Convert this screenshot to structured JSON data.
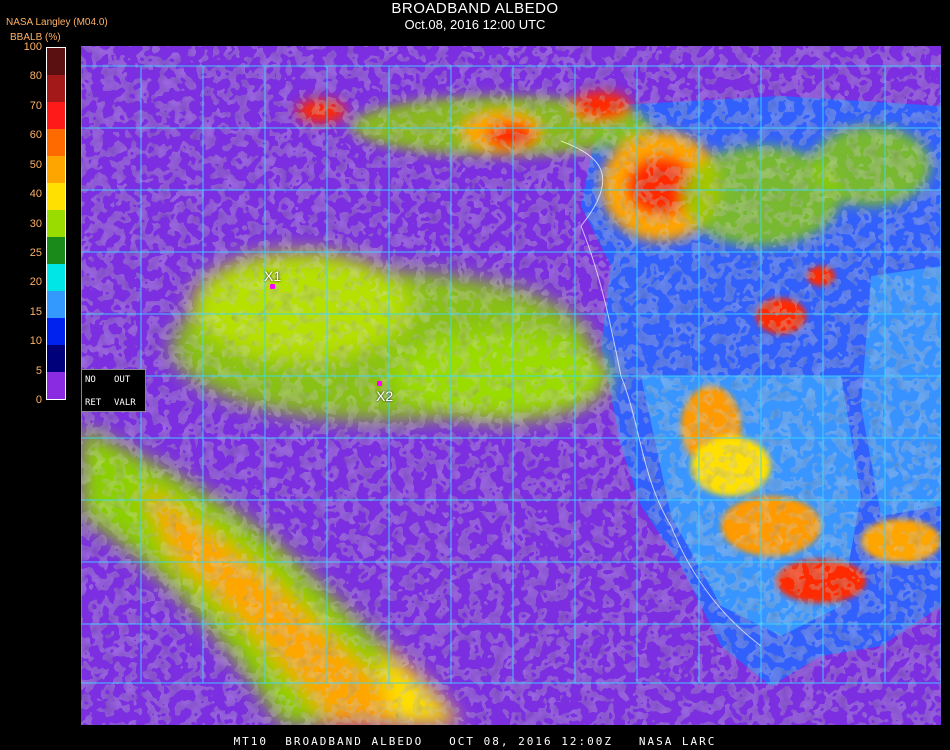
{
  "header": {
    "title": "BROADBAND ALBEDO",
    "subtitle": "Oct.08, 2016 12:00 UTC",
    "org": "NASA Langley (M04.0)",
    "unit_label": "BBALB (%)"
  },
  "colorbar": {
    "ticks": [
      "100",
      "80",
      "70",
      "60",
      "50",
      "40",
      "30",
      "25",
      "20",
      "15",
      "10",
      "5",
      "0"
    ],
    "colors": [
      "#5a1010",
      "#a31818",
      "#ff1a1a",
      "#ff6a00",
      "#ffa500",
      "#ffe000",
      "#9adb00",
      "#1a8a1a",
      "#00e5e5",
      "#3399ff",
      "#0022ee",
      "#00007a",
      "#8a2be2"
    ]
  },
  "legend_box": {
    "no": "NO",
    "out": "OUT",
    "ret": "RET",
    "valr": "VALR"
  },
  "markers": [
    {
      "label": "X1"
    },
    {
      "label": "X2"
    }
  ],
  "caption": "MT10  BROADBAND ALBEDO   OCT 08, 2016 12:00Z   NASA LARC",
  "map_colors": {
    "background": "#7b2fe0",
    "grid": "#3fd6ff",
    "ocean_blue": "#2a66ff",
    "land_blue": "#3a9bff",
    "cloud_yellow": "#e8f000",
    "cloud_green": "#8bd000",
    "cloud_orange": "#ff9a00",
    "cloud_red": "#ff2a00"
  }
}
